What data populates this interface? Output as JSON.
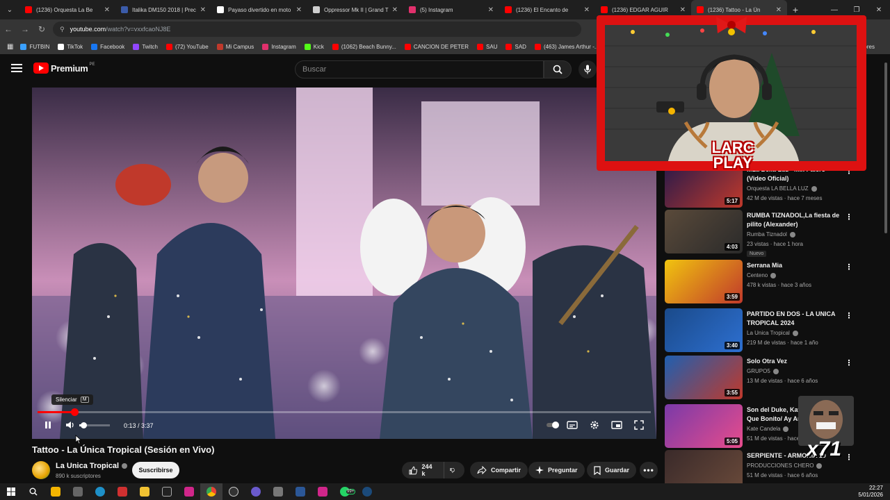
{
  "browser": {
    "tabs": [
      {
        "title": "(1236) Orquesta La Be",
        "color": "#ff0000"
      },
      {
        "title": "Italika DM150 2018 | Prec",
        "color": "#3b5ba9"
      },
      {
        "title": "Payaso divertido en moto",
        "color": "#ffffff"
      },
      {
        "title": "Oppressor Mk II | Grand T",
        "color": "#cfcfcf"
      },
      {
        "title": "(5) Instagram",
        "color": "#e1306c"
      },
      {
        "title": "(1236) El Encanto de",
        "color": "#ff0000"
      },
      {
        "title": "(1236) EDGAR AGUIR",
        "color": "#ff0000"
      },
      {
        "title": "(1236) Tattoo - La Ún",
        "color": "#ff0000",
        "active": true
      }
    ],
    "new_tab": "+",
    "url_host": "youtube.com",
    "url_path": "/watch?v=vxxfcaoNJ8E",
    "bookmarks": [
      {
        "label": "FUTBIN",
        "color": "#3aa0ff"
      },
      {
        "label": "TikTok",
        "color": "#ffffff"
      },
      {
        "label": "Facebook",
        "color": "#1877f2"
      },
      {
        "label": "Twitch",
        "color": "#9146ff"
      },
      {
        "label": "(72) YouTube",
        "color": "#ff0000"
      },
      {
        "label": "Mi Campus",
        "color": "#c0392b"
      },
      {
        "label": "Instagram",
        "color": "#e1306c"
      },
      {
        "label": "Kick",
        "color": "#53fc18"
      },
      {
        "label": "(1062) Beach Bunny...",
        "color": "#ff0000"
      },
      {
        "label": "CANCION DE PETER",
        "color": "#ff0000"
      },
      {
        "label": "SAU",
        "color": "#ff0000"
      },
      {
        "label": "SAD",
        "color": "#ff0000"
      },
      {
        "label": "(463) James Arthur -...",
        "color": "#ff0000"
      }
    ],
    "bookmarks_end": "adores"
  },
  "youtube": {
    "logo_text": "Premium",
    "logo_country": "PE",
    "search_placeholder": "Buscar"
  },
  "player": {
    "tooltip": "Silenciar",
    "tooltip_key": "M",
    "current_time": "0:13",
    "duration": "3:37",
    "time_display": "0:13 / 3:37",
    "progress_fraction": 0.06,
    "volume_fraction": 0.1
  },
  "video": {
    "title": "Tattoo - La Única Tropical (Sesión en Vivo)",
    "channel": "La Unica Tropical",
    "subscribers": "890 k suscriptores",
    "subscribe_label": "Suscribirse",
    "likes": "244 k",
    "share_label": "Compartir",
    "ask_label": "Preguntar",
    "save_label": "Guardar"
  },
  "overlay": {
    "logo_line1": "LARC",
    "logo_line2": "PLAY"
  },
  "emote_count": "x71",
  "recommendations": [
    {
      "title": "...La Bella Luz - Mix Palero (Video Oficial)",
      "channel": "Orquesta LA BELLA LUZ",
      "meta": "42 M de vistas · hace 7 meses",
      "duration": "5:17",
      "thumb": [
        "#2a1a4a",
        "#c0392b"
      ]
    },
    {
      "title": "RUMBA TIZNADOL,La fiesta de pilito (Alexander)",
      "channel": "Rumba Tiznadol",
      "meta": "23 vistas · hace 1 hora",
      "duration": "4:03",
      "badge": "Nuevo",
      "thumb": [
        "#5a4a3a",
        "#2a2a2a"
      ]
    },
    {
      "title": "Serrana Mia",
      "channel": "Centeno",
      "meta": "478 k vistas · hace 3 años",
      "duration": "3:59",
      "thumb": [
        "#f1c40f",
        "#c0392b"
      ]
    },
    {
      "title": "PARTIDO EN DOS - LA UNICA TROPICAL 2024",
      "channel": "La Unica Tropical",
      "meta": "219 M de vistas · hace 1 año",
      "duration": "3:40",
      "thumb": [
        "#1a4a8a",
        "#2d6fd0"
      ]
    },
    {
      "title": "Solo Otra Vez",
      "channel": "GRUPO5",
      "meta": "13 M de vistas · hace 6 años",
      "duration": "3:55",
      "thumb": [
        "#1f5fb0",
        "#c0392b"
      ]
    },
    {
      "title": "Son del Duke, Kate Candela - Que Bonito/ Ay Amor",
      "channel": "Kate Candela",
      "meta": "51 M de vistas · hace",
      "duration": "5:05",
      "thumb": [
        "#7a3aa8",
        "#e74c8c"
      ]
    },
    {
      "title": "SERPIENTE - ARMONÍA 10",
      "channel": "PRODUCCIONES CHERO",
      "meta": "51 M de vistas · hace 6 años",
      "duration": "",
      "thumb": [
        "#3a2a2a",
        "#6a4a3a"
      ]
    }
  ],
  "taskbar": {
    "notif": "99+",
    "time": "22:27",
    "date": "5/01/2026"
  }
}
